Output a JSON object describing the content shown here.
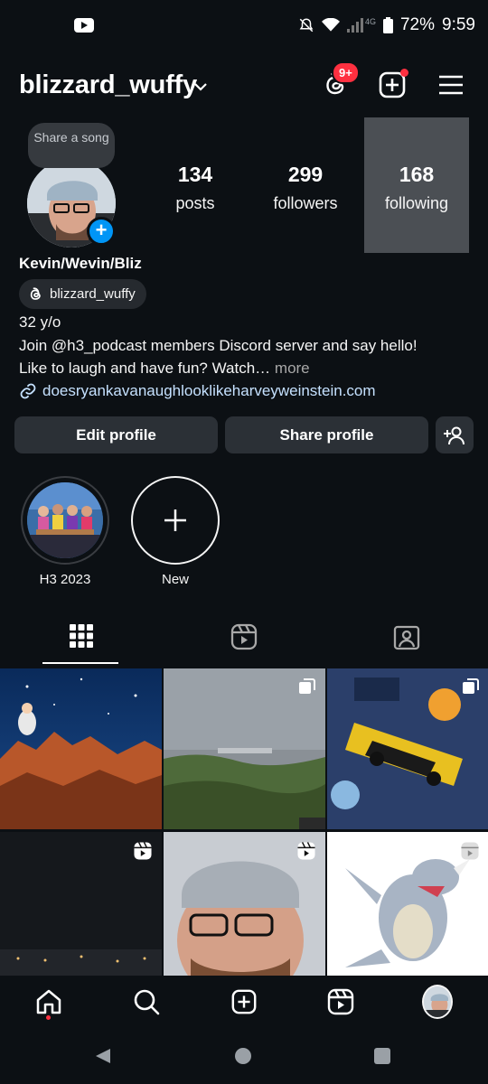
{
  "status_bar": {
    "battery": "72%",
    "time": "9:59",
    "network": "4G"
  },
  "header": {
    "username": "blizzard_wuffy",
    "threads_badge": "9+"
  },
  "profile": {
    "note_bubble": "Share a song",
    "stats": [
      {
        "value": "134",
        "label": "posts"
      },
      {
        "value": "299",
        "label": "followers"
      },
      {
        "value": "168",
        "label": "following"
      }
    ],
    "display_name": "Kevin/Wevin/Bliz",
    "threads_handle": "blizzard_wuffy",
    "bio_line1": "32 y/o",
    "bio_line2": "Join @h3_podcast members Discord server and say hello!",
    "bio_line3": "Like to laugh and have fun? Watch…",
    "bio_more": "more",
    "link": "doesryankavanaughlooklikeharveyweinstein.com"
  },
  "buttons": {
    "edit": "Edit profile",
    "share": "Share profile"
  },
  "highlights": [
    {
      "label": "H3 2023"
    },
    {
      "label": "New"
    }
  ],
  "colors": {
    "background": "#0c1014",
    "button": "#2b3036",
    "accent_blue": "#0095f6",
    "notification_red": "#ff3040",
    "link": "#c5e1ff"
  },
  "icons": {
    "threads": "threads-icon",
    "create": "plus-square-icon",
    "menu": "hamburger-menu-icon",
    "grid": "grid-icon",
    "reels": "reels-icon",
    "tagged": "tagged-person-icon"
  }
}
